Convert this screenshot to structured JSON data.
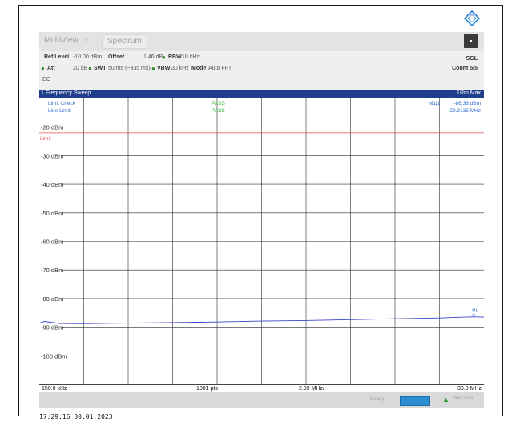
{
  "tabs": {
    "multiview": "MultiView",
    "spectrum": "Spectrum",
    "star": "•",
    "close_glyph": "▪"
  },
  "params": {
    "ref_level_label": "Ref Level",
    "ref_level_value": "-10.00 dBm",
    "offset_label": "Offset",
    "offset_value": "1.46 dB",
    "rbw_label": "RBW",
    "rbw_value": "10 kHz",
    "att_label": "Att",
    "att_value": "20 dB",
    "swt_label": "SWT",
    "swt_value": "50 ms (~335 ms)",
    "vbw_label": "VBW",
    "vbw_value": "30 kHz",
    "mode_label": "Mode",
    "mode_value": "Auto FFT",
    "coupling": "DC",
    "sgl": "SGL",
    "count": "Count 5/5"
  },
  "sweep": {
    "title": "1 Frequency Sweep",
    "trace_label": "1Rm Max",
    "limit_check_label": "Limit Check",
    "line_limit_label": "Line Limit",
    "limit_check_result": "PASS",
    "line_limit_result": "PASS",
    "marker_label": "M1[1]",
    "marker_level": "-86.36 dBm",
    "marker_freq": "29.3135 MHz",
    "limit_text": "Limit"
  },
  "bottom": {
    "start": "150.0 kHz",
    "points": "1001 pts",
    "span_div": "2.99 MHz/",
    "stop": "30.0 MHz"
  },
  "status": {
    "ready": "Ready",
    "warn_glyph": "▲",
    "warn_text": "Warn / Info"
  },
  "timestamp": "17:29:16  30.01.2023",
  "colors": {
    "title_bar": "#1f3f8c",
    "trace": "#3a44c8",
    "limit_line": "#e05050",
    "pass": "#2fb82f",
    "marker_text": "#2f6fd0"
  },
  "chart_data": {
    "type": "line",
    "ylabels": [
      "-20 dBm",
      "-30 dBm",
      "-40 dBm",
      "-50 dBm",
      "-60 dBm",
      "-70 dBm",
      "-80 dBm",
      "-90 dBm",
      "-100 dBm"
    ],
    "ylim": [
      -110,
      -10
    ],
    "xlim": [
      0.15,
      30.0
    ],
    "limit_level": -22,
    "series": [
      {
        "x": [
          0.15,
          0.5,
          1.5,
          3,
          6,
          9,
          12,
          15,
          18,
          21,
          24,
          27,
          29.3135,
          30.0
        ],
        "values": [
          -88.6,
          -88.0,
          -88.7,
          -88.8,
          -88.6,
          -88.4,
          -88.2,
          -87.9,
          -87.7,
          -87.4,
          -87.1,
          -86.8,
          -86.4,
          -86.5
        ]
      }
    ],
    "marker": {
      "x": 29.3135,
      "y": -86.36
    },
    "grid": true
  }
}
